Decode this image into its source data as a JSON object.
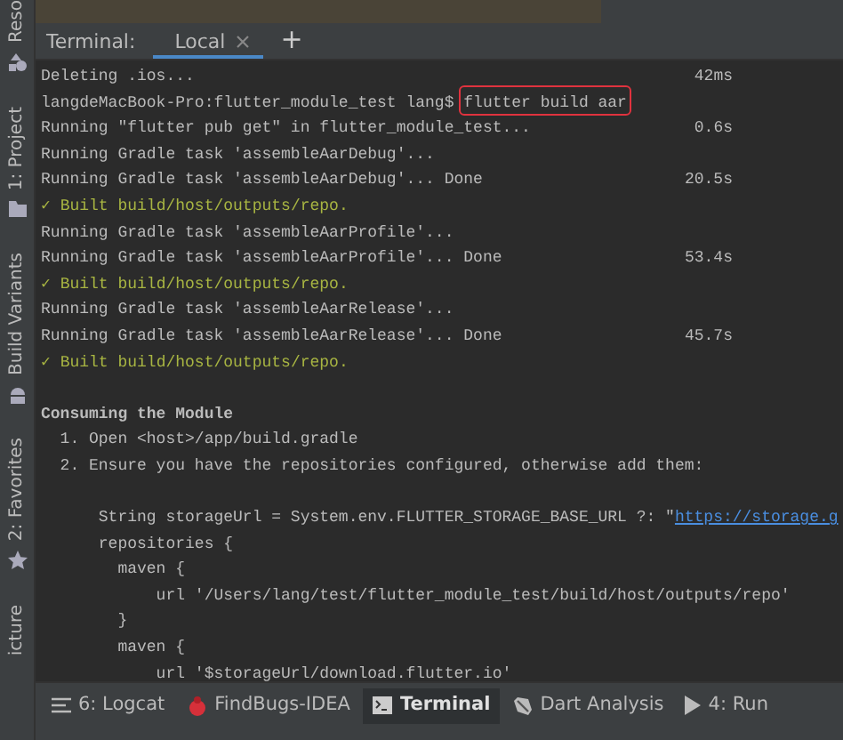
{
  "sidebar": {
    "items": [
      {
        "label": "Reso",
        "kind": "resource"
      },
      {
        "label": "1: Project",
        "kind": "folder"
      },
      {
        "label": "Build Variants",
        "kind": "android"
      },
      {
        "label": "2: Favorites",
        "kind": "star"
      },
      {
        "label": "icture",
        "kind": "plain"
      }
    ]
  },
  "terminal": {
    "title": "Terminal:",
    "tabs": [
      {
        "label": "Local",
        "selected": true
      }
    ],
    "add_button": "+",
    "lines": [
      {
        "kind": "plain",
        "text": "Deleting .ios...",
        "time": "42ms"
      },
      {
        "kind": "command",
        "prompt": "langdeMacBook-Pro:flutter_module_test lang$ ",
        "command": "flutter build aar",
        "highlighted": true
      },
      {
        "kind": "plain",
        "text": "Running \"flutter pub get\" in flutter_module_test...",
        "time": "0.6s"
      },
      {
        "kind": "plain",
        "text": "Running Gradle task 'assembleAarDebug'..."
      },
      {
        "kind": "plain",
        "text": "Running Gradle task 'assembleAarDebug'... Done",
        "time": "20.5s"
      },
      {
        "kind": "success",
        "text": "✓ Built build/host/outputs/repo."
      },
      {
        "kind": "plain",
        "text": "Running Gradle task 'assembleAarProfile'..."
      },
      {
        "kind": "plain",
        "text": "Running Gradle task 'assembleAarProfile'... Done",
        "time": "53.4s"
      },
      {
        "kind": "success",
        "text": "✓ Built build/host/outputs/repo."
      },
      {
        "kind": "plain",
        "text": "Running Gradle task 'assembleAarRelease'..."
      },
      {
        "kind": "plain",
        "text": "Running Gradle task 'assembleAarRelease'... Done",
        "time": "45.7s"
      },
      {
        "kind": "success",
        "text": "✓ Built build/host/outputs/repo."
      },
      {
        "kind": "blank"
      },
      {
        "kind": "heading",
        "text": "Consuming the Module"
      },
      {
        "kind": "plain",
        "text": "  1. Open <host>/app/build.gradle"
      },
      {
        "kind": "plain",
        "text": "  2. Ensure you have the repositories configured, otherwise add them:"
      },
      {
        "kind": "blank"
      },
      {
        "kind": "link-line",
        "text": "      String storageUrl = System.env.FLUTTER_STORAGE_BASE_URL ?: \"",
        "link": "https://storage.g"
      },
      {
        "kind": "plain",
        "text": "      repositories {"
      },
      {
        "kind": "plain",
        "text": "        maven {"
      },
      {
        "kind": "plain",
        "text": "            url '/Users/lang/test/flutter_module_test/build/host/outputs/repo'"
      },
      {
        "kind": "plain",
        "text": "        }"
      },
      {
        "kind": "plain",
        "text": "        maven {"
      },
      {
        "kind": "plain",
        "text": "            url '$storageUrl/download.flutter.io'"
      }
    ]
  },
  "bottom_bar": {
    "items": [
      {
        "label": "6: Logcat",
        "kind": "logcat",
        "selected": false
      },
      {
        "label": "FindBugs-IDEA",
        "kind": "bug",
        "selected": false
      },
      {
        "label": "Terminal",
        "kind": "terminal",
        "selected": true
      },
      {
        "label": "Dart Analysis",
        "kind": "dart",
        "selected": false
      },
      {
        "label": "4: Run",
        "kind": "run",
        "selected": false
      }
    ]
  }
}
